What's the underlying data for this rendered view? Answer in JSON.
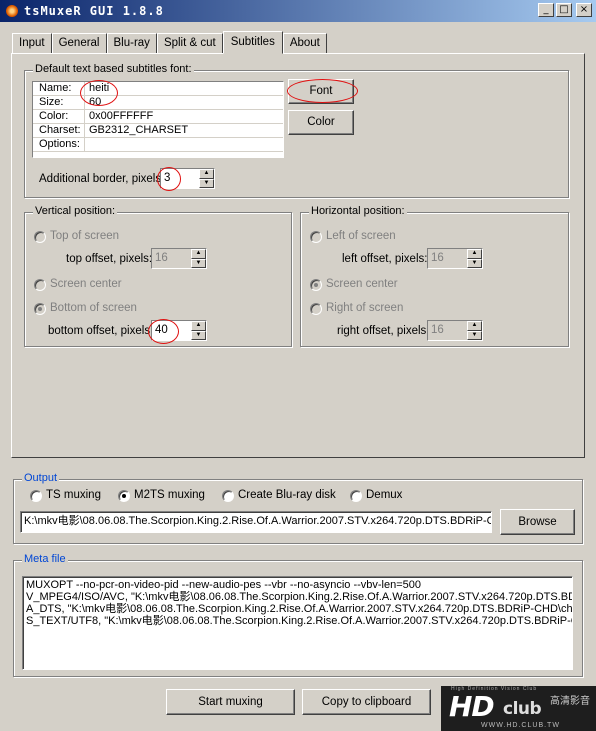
{
  "window": {
    "title": "tsMuxeR GUI 1.8.8",
    "minimize": "_",
    "maximize": "□",
    "close": "×"
  },
  "tabs": [
    "Input",
    "General",
    "Blu-ray",
    "Split & cut",
    "Subtitles",
    "About"
  ],
  "font_group": {
    "title": "Default text based subtitles font:",
    "rows": [
      {
        "key": "Name:",
        "value": "heiti"
      },
      {
        "key": "Size:",
        "value": "60"
      },
      {
        "key": "Color:",
        "value": "0x00FFFFFF"
      },
      {
        "key": "Charset:",
        "value": "GB2312_CHARSET"
      },
      {
        "key": "Options:",
        "value": ""
      }
    ],
    "font_button": "Font",
    "color_button": "Color",
    "border_label": "Additional border, pixels:",
    "border_value": "3"
  },
  "vertical": {
    "title": "Vertical position:",
    "top_label": "Top of screen",
    "top_offset_label": "top offset, pixels:",
    "top_offset_value": "16",
    "center_label": "Screen center",
    "bottom_label": "Bottom of screen",
    "bottom_offset_label": "bottom offset, pixels:",
    "bottom_offset_value": "40"
  },
  "horizontal": {
    "title": "Horizontal position:",
    "left_label": "Left of screen",
    "left_offset_label": "left offset, pixels:",
    "left_offset_value": "16",
    "center_label": "Screen center",
    "right_label": "Right of screen",
    "right_offset_label": "right offset, pixels:",
    "right_offset_value": "16"
  },
  "output": {
    "title": "Output",
    "options": [
      "TS muxing",
      "M2TS muxing",
      "Create Blu-ray disk",
      "Demux"
    ],
    "selected": "M2TS muxing",
    "path": "K:\\mkv电影\\08.06.08.The.Scorpion.King.2.Rise.Of.A.Warrior.2007.STV.x264.720p.DTS.BDRiP-CH",
    "browse": "Browse"
  },
  "meta": {
    "title": "Meta file",
    "lines": [
      "MUXOPT --no-pcr-on-video-pid --new-audio-pes --vbr  --no-asyncio --vbv-len=500",
      "V_MPEG4/ISO/AVC, \"K:\\mkv电影\\08.06.08.The.Scorpion.King.2.Rise.Of.A.Warrior.2007.STV.x264.720p.DTS.BD",
      "A_DTS, \"K:\\mkv电影\\08.06.08.The.Scorpion.King.2.Rise.Of.A.Warrior.2007.STV.x264.720p.DTS.BDRiP-CHD\\ch",
      "S_TEXT/UTF8, \"K:\\mkv电影\\08.06.08.The.Scorpion.King.2.Rise.Of.A.Warrior.2007.STV.x264.720p.DTS.BDRiP-C"
    ]
  },
  "buttons": {
    "start": "Start muxing",
    "copy": "Copy to clipboard"
  },
  "watermark": {
    "brand_hd": "HD",
    "brand_club": "club",
    "cn": "高清影音",
    "tagline": "High Definition Vision Club",
    "url": "WWW.HD.CLUB.TW"
  }
}
